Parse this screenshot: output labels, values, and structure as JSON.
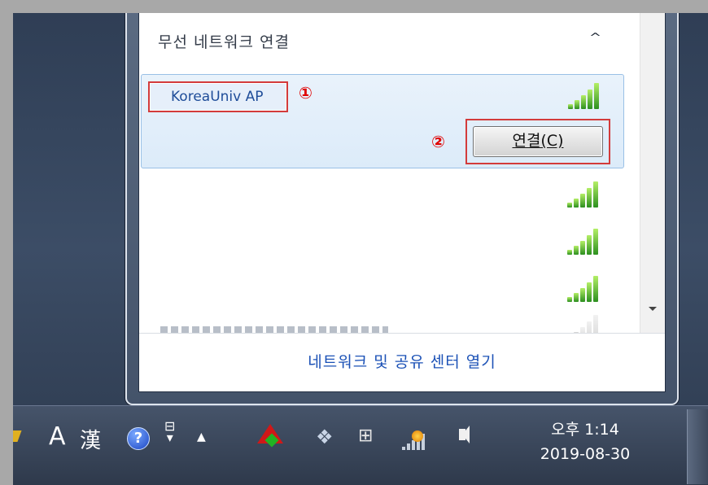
{
  "flyout": {
    "section_title": "무선 네트워크 연결",
    "collapse_glyph": "^",
    "selected_network": {
      "name": "KoreaUniv AP",
      "connect_label": "연결(C)",
      "signal_bars": 5
    },
    "other_networks": [
      {
        "signal_bars": 5
      },
      {
        "signal_bars": 5
      },
      {
        "signal_bars": 5
      },
      {
        "signal_bars": 2
      }
    ],
    "footer_link": "네트워크 및 공유 센터 열기",
    "annotations": {
      "first": "①",
      "second": "②"
    },
    "colors": {
      "selection_border": "#99c0e6",
      "annotation": "#e00000",
      "signal_green": "#2c8f1f",
      "link": "#1b51b6"
    }
  },
  "taskbar": {
    "ime_mode": "A",
    "ime_hanja": "漢",
    "help_glyph": "?",
    "show_hidden_glyph": "▲",
    "clock": {
      "time": "오후 1:14",
      "date": "2019-08-30"
    },
    "icons": [
      "pen-icon",
      "help-icon",
      "ime-options-icon",
      "show-hidden-icon",
      "tray-app-icon",
      "dropbox-icon",
      "power-icon",
      "network-icon",
      "volume-icon"
    ]
  }
}
